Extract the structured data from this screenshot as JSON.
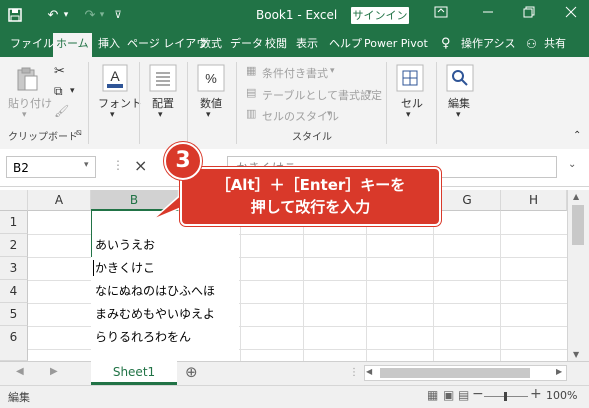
{
  "titlebar": {
    "title": "Book1 - Excel",
    "signin": "サインイン",
    "save_icon": "save-icon",
    "undo_icon": "undo-icon",
    "redo_icon": "redo-icon"
  },
  "tabs": [
    "ファイル",
    "ホーム",
    "挿入",
    "ページ レイアウ",
    "数式",
    "データ",
    "校閲",
    "表示",
    "ヘルプ",
    "Power Pivot"
  ],
  "tabs_right": {
    "tellme": "操作アシス",
    "share": "共有"
  },
  "ribbon": {
    "paste": "貼り付け",
    "clipboard_group": "クリップボード",
    "font": "フォント",
    "alignment": "配置",
    "number": "数値",
    "conditional": "条件付き書式",
    "table": "テーブルとして書式設定",
    "cellstyle": "セルのスタイル",
    "styles_group": "スタイル",
    "cells": "セル",
    "editing": "編集"
  },
  "formula_bar": {
    "namebox": "B2",
    "cancel": "×",
    "content": "かきくけこ"
  },
  "columns": [
    "A",
    "B",
    "C",
    "D",
    "E",
    "F",
    "G",
    "H"
  ],
  "rows": [
    "1",
    "2",
    "3",
    "4",
    "5",
    "6"
  ],
  "cells": {
    "b2": "あいうえお",
    "b3": "かきくけこ",
    "b4": "なにぬねのはひふへほ",
    "b5": "まみむめもやいゆえよ",
    "b6": "らりるれろわをん"
  },
  "sheet": {
    "tab": "Sheet1",
    "add": "⊕"
  },
  "status": {
    "mode": "編集",
    "zoom": "100%"
  },
  "callout": {
    "number": "3",
    "line1": "［Alt］＋［Enter］キーを",
    "line2": "押して改行を入力"
  },
  "colors": {
    "excel_green": "#217346",
    "callout_red": "#d9392a"
  }
}
